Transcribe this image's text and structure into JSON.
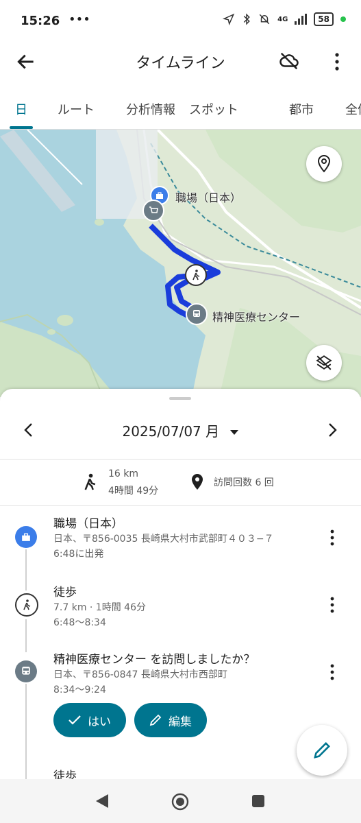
{
  "status": {
    "time": "15:26",
    "notif": "•••",
    "network": "4G",
    "battery": "58"
  },
  "appbar": {
    "title": "タイムライン"
  },
  "tabs": [
    {
      "label": "日"
    },
    {
      "label": "ルート"
    },
    {
      "label": "分析情報"
    },
    {
      "label": "スポット"
    },
    {
      "label": "都市"
    },
    {
      "label": "全体"
    }
  ],
  "map": {
    "label_work": "職場（日本）",
    "label_center": "精神医療センター"
  },
  "datebar": {
    "date": "2025/07/07 月"
  },
  "summary": {
    "distance": "16 km",
    "duration": "4時間 49分",
    "visits": "訪問回数 6 回"
  },
  "entries": [
    {
      "title": "職場（日本）",
      "line1": "日本、〒856-0035 長崎県大村市武部町４０３−７",
      "line2": "6:48に出発"
    },
    {
      "title": "徒歩",
      "line1": "7.7 km · 1時間 46分",
      "line2": "6:48〜8:34"
    },
    {
      "title": "精神医療センター を訪問しましたか？",
      "line1": "日本、〒856-0847 長崎県大村市西部町",
      "line2": "8:34〜9:24"
    },
    {
      "title": "徒歩",
      "line1": "",
      "line2": ""
    }
  ],
  "actions": {
    "yes": "はい",
    "edit": "編集"
  },
  "colors": {
    "accent": "#00758f",
    "route": "#1a3ddb",
    "water": "#aad3df",
    "land": "#dfe9d5"
  }
}
